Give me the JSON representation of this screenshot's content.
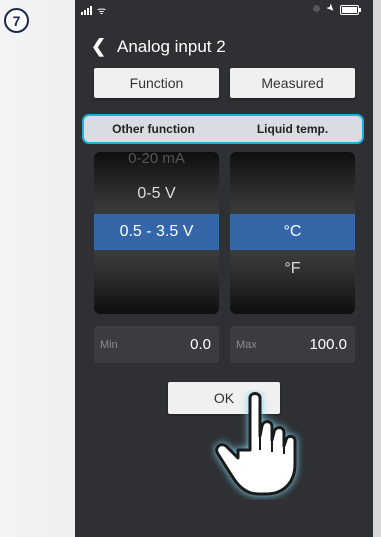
{
  "step": "7",
  "statusbar": {
    "wifi_glyph": "ᯤ"
  },
  "nav": {
    "back_glyph": "❮",
    "title": "Analog input 2"
  },
  "buttons": {
    "function": "Function",
    "measured": "Measured",
    "ok": "OK"
  },
  "summary": {
    "left": "Other function",
    "right": "Liquid temp."
  },
  "picker_left": {
    "above": "0-20 mA",
    "prev": "0-5 V",
    "selected": "0.5 - 3.5 V"
  },
  "picker_right": {
    "selected": "°C",
    "next": "°F"
  },
  "fields": {
    "min": {
      "label": "Min",
      "value": "0.0"
    },
    "max": {
      "label": "Max",
      "value": "100.0"
    }
  },
  "colors": {
    "accent": "#1eaee0",
    "selection": "#3466a8",
    "screen_bg": "#2e3033"
  }
}
